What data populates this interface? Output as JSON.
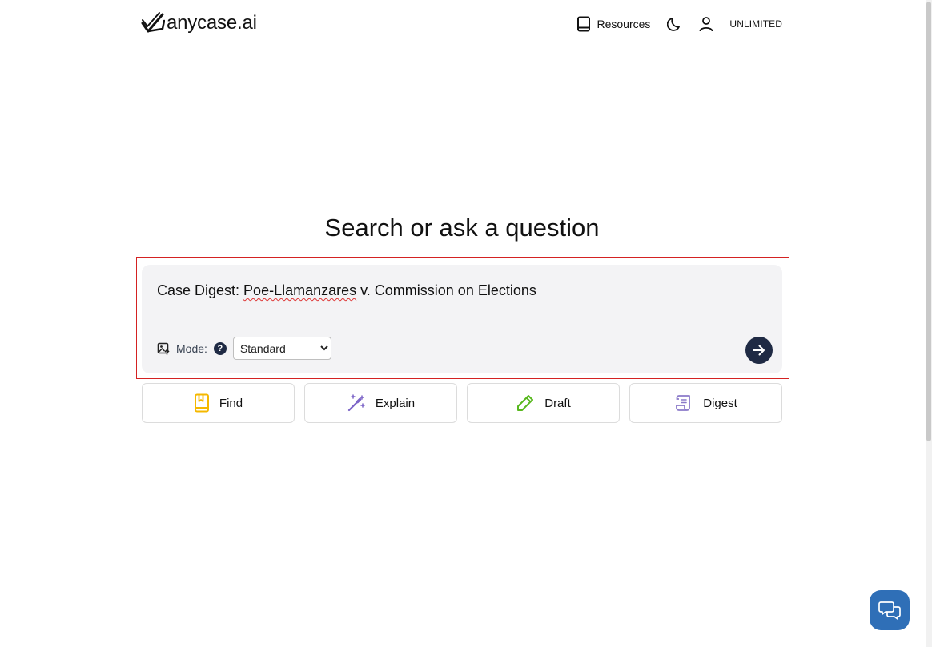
{
  "brand": {
    "name": "anycase.ai"
  },
  "nav": {
    "resources_label": "Resources",
    "plan_label": "UNLIMITED"
  },
  "main": {
    "title": "Search or ask a question"
  },
  "search": {
    "query_prefix": "Case Digest: ",
    "query_flagged_word": "Poe-Llamanzares",
    "query_suffix": " v. Commission on Elections",
    "mode_label": "Mode:",
    "mode_help_glyph": "?",
    "mode_selected": "Standard"
  },
  "actions": [
    {
      "label": "Find",
      "icon": "bookmark-book-icon",
      "color": "#f5b800"
    },
    {
      "label": "Explain",
      "icon": "magic-wand-icon",
      "color": "#7b63c7"
    },
    {
      "label": "Draft",
      "icon": "pencil-icon",
      "color": "#58b81e"
    },
    {
      "label": "Digest",
      "icon": "scroll-icon",
      "color": "#8b7ac9"
    }
  ],
  "colors": {
    "accent_dark": "#1f2a44",
    "chat": "#2f6fb7",
    "highlight_border": "#d42222"
  }
}
